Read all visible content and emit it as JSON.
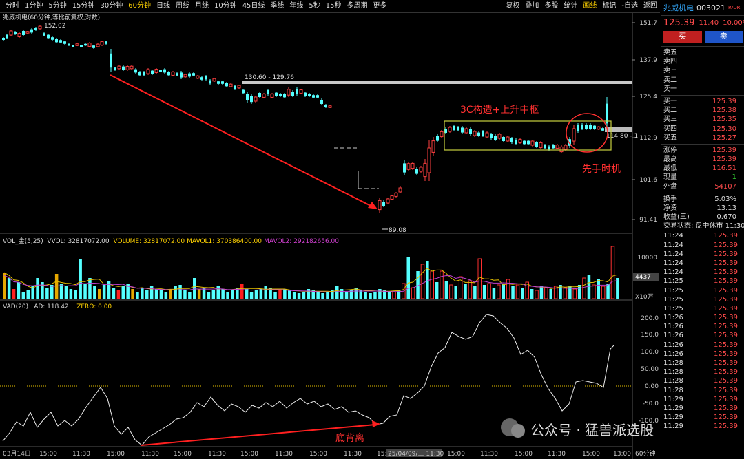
{
  "toolbar": {
    "periods": [
      "分时",
      "1分钟",
      "5分钟",
      "15分钟",
      "30分钟",
      "60分钟",
      "日线",
      "周线",
      "月线",
      "10分钟",
      "45日线",
      "季线",
      "年线",
      "5秒",
      "15秒",
      "多周期",
      "更多"
    ],
    "active_period": "60分钟",
    "right": [
      "复权",
      "叠加",
      "多股",
      "统计",
      "画线",
      "标记",
      "-自选",
      "返回"
    ],
    "active_right": "画线"
  },
  "chart": {
    "title": "兆威机电(60分钟,等比前复权,对数)",
    "price_labels": [
      "151.7",
      "137.9",
      "125.4",
      "112.9",
      "101.6",
      "91.41"
    ],
    "high_label": "152.02",
    "low_label": "89.08",
    "zone_label": "130.60 - 129.76",
    "zone2_label": "114.80 - 1",
    "annotation_center": "3C构造+上升中枢",
    "annotation_circle": "先手时机",
    "annotation_div": "底背离",
    "watermark": "公众号 · 猛兽派选股",
    "vol_legend": [
      {
        "text": "VOL_金(5,25)",
        "color": "#dddddd"
      },
      {
        "text": "VVOL: 32817072.00",
        "color": "#dddddd"
      },
      {
        "text": "VOLUME: 32817072.00",
        "color": "#ffd200"
      },
      {
        "text": "MAVOL1: 370386400.00",
        "color": "#ffd200"
      },
      {
        "text": "MAVOL2: 292182656.00",
        "color": "#d040d0"
      }
    ],
    "vol_labels": [
      "10000",
      "4437",
      "X10万"
    ],
    "vad_legend": [
      {
        "text": "VAD(20)",
        "color": "#dddddd"
      },
      {
        "text": "AD: 118.42",
        "color": "#dddddd"
      },
      {
        "text": "ZERO: 0.00",
        "color": "#ffd200"
      }
    ],
    "vad_labels": [
      "200.0",
      "150.0",
      "100.0",
      "50.00",
      "0.00",
      "-50.0",
      "-100.0"
    ],
    "x_labels": [
      "03月14日",
      "15:00",
      "11:30",
      "15:00",
      "11:30",
      "15:00",
      "11:30",
      "15:00",
      "11:30",
      "15:00",
      "11:30",
      "15:00",
      "25/04/09/三 11:30",
      "15:00",
      "11:30",
      "15:00",
      "11:30",
      "15:00",
      "13:00"
    ],
    "x_unit": "60分钟"
  },
  "side": {
    "name": "兆威机电",
    "code": "003021",
    "tag": "R/DR",
    "price": "125.39",
    "change": "11.40",
    "pct": "10.00%",
    "buy_label": "买",
    "sell_label": "卖",
    "asks": [
      {
        "l": "卖五",
        "v": ""
      },
      {
        "l": "卖四",
        "v": ""
      },
      {
        "l": "卖三",
        "v": ""
      },
      {
        "l": "卖二",
        "v": ""
      },
      {
        "l": "卖一",
        "v": ""
      }
    ],
    "bids": [
      {
        "l": "买一",
        "v": "125.39"
      },
      {
        "l": "买二",
        "v": "125.38"
      },
      {
        "l": "买三",
        "v": "125.35"
      },
      {
        "l": "买四",
        "v": "125.30"
      },
      {
        "l": "买五",
        "v": "125.27"
      }
    ],
    "stats": [
      {
        "l": "涨停",
        "v": "125.39"
      },
      {
        "l": "最高",
        "v": "125.39"
      },
      {
        "l": "最低",
        "v": "116.51"
      },
      {
        "l": "现量",
        "v": "1"
      },
      {
        "l": "外盘",
        "v": "54107"
      }
    ],
    "stats2": [
      {
        "l": "换手",
        "v": "5.03%"
      },
      {
        "l": "净资",
        "v": "13.13"
      },
      {
        "l": "收益(三)",
        "v": "0.670"
      }
    ],
    "status": "交易状态: 盘中休市 11:30",
    "trades": [
      "11:24",
      "11:24",
      "11:24",
      "11:24",
      "11:24",
      "11:25",
      "11:25",
      "11:25",
      "11:25",
      "11:26",
      "11:26",
      "11:26",
      "11:26",
      "11:26",
      "11:28",
      "11:28",
      "11:28",
      "11:28",
      "11:29",
      "11:29",
      "11:29",
      "11:29"
    ],
    "trade_price": "125.39"
  }
}
